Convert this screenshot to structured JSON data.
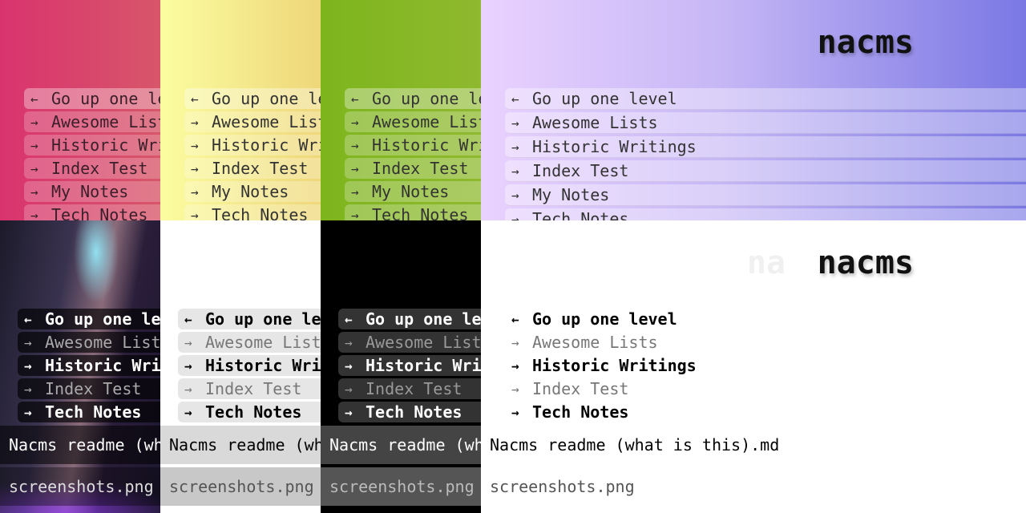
{
  "site_title": "nacms",
  "ghost_title": "na",
  "nav_items": [
    {
      "arrow": "←",
      "label": "Go up one level"
    },
    {
      "arrow": "→",
      "label": "Awesome Lists"
    },
    {
      "arrow": "→",
      "label": "Historic Writings"
    },
    {
      "arrow": "→",
      "label": "Index Test"
    },
    {
      "arrow": "→",
      "label": "My Notes"
    },
    {
      "arrow": "→",
      "label": "Tech Notes"
    }
  ],
  "nav_items_bottom": [
    {
      "arrow": "←",
      "label": "Go up one level"
    },
    {
      "arrow": "→",
      "label": "Awesome Lists"
    },
    {
      "arrow": "→",
      "label": "Historic Writings"
    },
    {
      "arrow": "→",
      "label": "Index Test"
    },
    {
      "arrow": "→",
      "label": "Tech Notes"
    }
  ],
  "files": {
    "readme": "Nacms readme (what is this).md",
    "screenshots": "screenshots.png"
  },
  "colors": {
    "pink": "#d63a6e",
    "yellow": "#f5e97a",
    "green": "#7fb81f",
    "purple_start": "#ead4ff",
    "purple_end": "#7b78e6"
  }
}
